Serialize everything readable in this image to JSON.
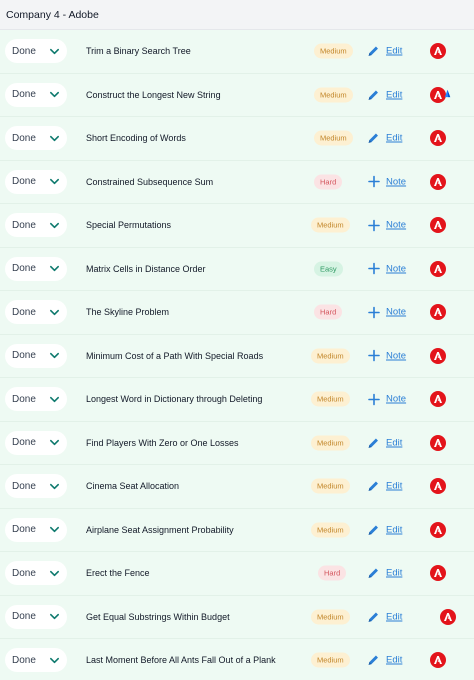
{
  "header": {
    "title": "Company 4 - Adobe"
  },
  "colors": {
    "background": "#eefaf3",
    "link": "#2b7fd6",
    "adobe_red": "#e3141b"
  },
  "rows": [
    {
      "status": "Done",
      "title": "Trim a Binary Search Tree",
      "difficulty": "Medium",
      "action": "Edit",
      "action_icon": "pencil-icon",
      "logos": [
        "adobe-logo"
      ]
    },
    {
      "status": "Done",
      "title": "Construct the Longest New String",
      "difficulty": "Medium",
      "action": "Edit",
      "action_icon": "pencil-icon",
      "logos": [
        "adobe-logo",
        "atlassian-logo"
      ]
    },
    {
      "status": "Done",
      "title": "Short Encoding of Words",
      "difficulty": "Medium",
      "action": "Edit",
      "action_icon": "pencil-icon",
      "logos": [
        "adobe-logo"
      ]
    },
    {
      "status": "Done",
      "title": "Constrained Subsequence Sum",
      "difficulty": "Hard",
      "action": "Note",
      "action_icon": "plus-icon",
      "logos": [
        "adobe-logo"
      ]
    },
    {
      "status": "Done",
      "title": "Special Permutations",
      "difficulty": "Medium",
      "action": "Note",
      "action_icon": "plus-icon",
      "logos": [
        "adobe-logo"
      ]
    },
    {
      "status": "Done",
      "title": "Matrix Cells in Distance Order",
      "difficulty": "Easy",
      "action": "Note",
      "action_icon": "plus-icon",
      "logos": [
        "adobe-logo"
      ]
    },
    {
      "status": "Done",
      "title": "The Skyline Problem",
      "difficulty": "Hard",
      "action": "Note",
      "action_icon": "plus-icon",
      "logos": [
        "adobe-logo"
      ]
    },
    {
      "status": "Done",
      "title": "Minimum Cost of a Path With Special Roads",
      "difficulty": "Medium",
      "action": "Note",
      "action_icon": "plus-icon",
      "logos": [
        "adobe-logo"
      ]
    },
    {
      "status": "Done",
      "title": "Longest Word in Dictionary through Deleting",
      "difficulty": "Medium",
      "action": "Note",
      "action_icon": "plus-icon",
      "logos": [
        "adobe-logo"
      ]
    },
    {
      "status": "Done",
      "title": "Find Players With Zero or One Losses",
      "difficulty": "Medium",
      "action": "Edit",
      "action_icon": "pencil-icon",
      "logos": [
        "adobe-logo"
      ]
    },
    {
      "status": "Done",
      "title": "Cinema Seat Allocation",
      "difficulty": "Medium",
      "action": "Edit",
      "action_icon": "pencil-icon",
      "logos": [
        "adobe-logo"
      ]
    },
    {
      "status": "Done",
      "title": "Airplane Seat Assignment Probability",
      "difficulty": "Medium",
      "action": "Edit",
      "action_icon": "pencil-icon",
      "logos": [
        "adobe-logo"
      ]
    },
    {
      "status": "Done",
      "title": "Erect the Fence",
      "difficulty": "Hard",
      "action": "Edit",
      "action_icon": "pencil-icon",
      "logos": [
        "adobe-logo"
      ]
    },
    {
      "status": "Done",
      "title": "Get Equal Substrings Within Budget",
      "difficulty": "Medium",
      "action": "Edit",
      "action_icon": "pencil-icon",
      "logos": [
        "adobe-logo"
      ]
    },
    {
      "status": "Done",
      "title": "Last Moment Before All Ants Fall Out of a Plank",
      "difficulty": "Medium",
      "action": "Edit",
      "action_icon": "pencil-icon",
      "logos": [
        "adobe-logo"
      ]
    }
  ]
}
